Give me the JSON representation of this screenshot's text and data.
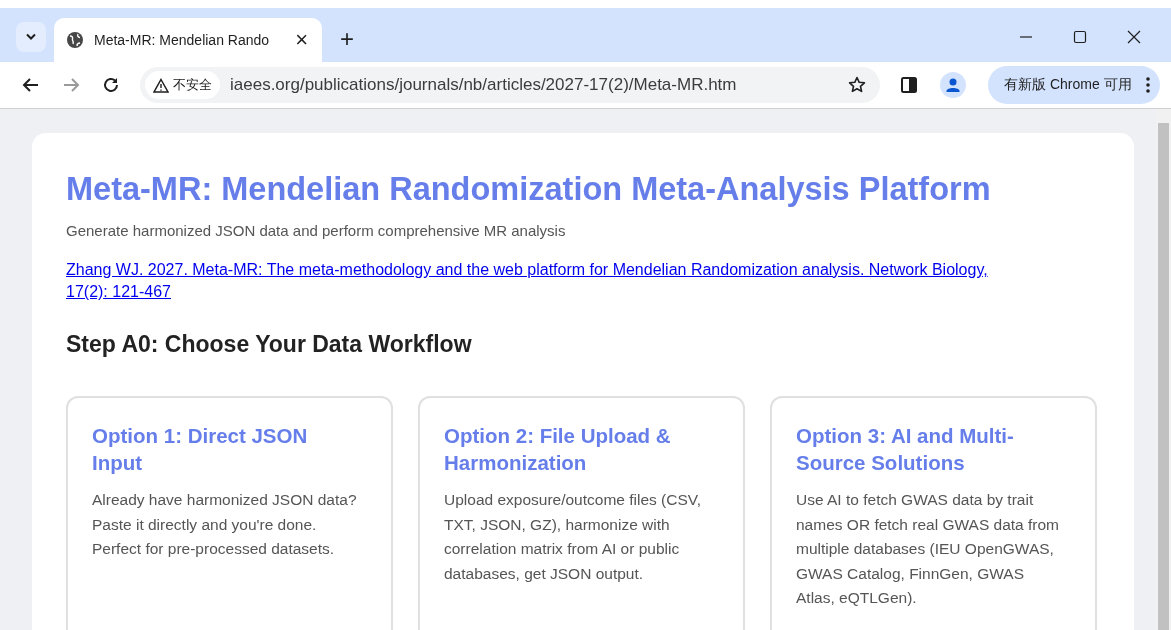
{
  "browser": {
    "tab": {
      "title": "Meta-MR: Mendelian Rando",
      "close": "×"
    },
    "new_tab": "+",
    "address": {
      "security": "不安全",
      "url": "iaees.org/publications/journals/nb/articles/2027-17(2)/Meta-MR.htm"
    },
    "update_button": "有新版 Chrome 可用"
  },
  "page": {
    "title": "Meta-MR: Mendelian Randomization Meta-Analysis Platform",
    "subtitle": "Generate harmonized JSON data and perform comprehensive MR analysis",
    "citation_link": "Zhang WJ. 2027. Meta-MR: The meta-methodology and the web platform for Mendelian Randomization analysis. Network Biology, 17(2): 121-467",
    "step_heading": "Step A0: Choose Your Data Workflow",
    "options": [
      {
        "title": "Option 1: Direct JSON Input",
        "description": "Already have harmonized JSON data? Paste it directly and you're done. Perfect for pre-processed datasets."
      },
      {
        "title": "Option 2: File Upload & Harmonization",
        "description": "Upload exposure/outcome files (CSV, TXT, JSON, GZ), harmonize with correlation matrix from AI or public databases, get JSON output."
      },
      {
        "title": "Option 3: AI and Multi-Source Solutions",
        "description": "Use AI to fetch GWAS data by trait names OR fetch real GWAS data from multiple databases (IEU OpenGWAS, GWAS Catalog, FinnGen, GWAS Atlas, eQTLGen)."
      }
    ]
  }
}
